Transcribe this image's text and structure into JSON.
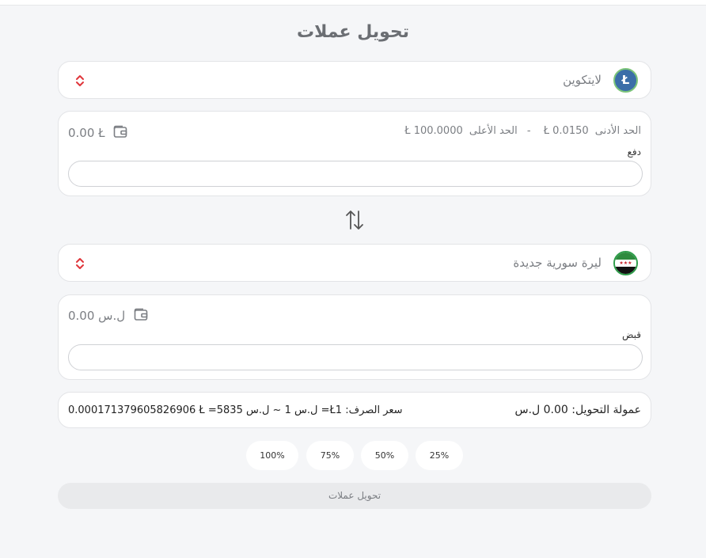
{
  "page": {
    "title": "تحويل عملات"
  },
  "from": {
    "currency_name": "لايتكوين",
    "coin_symbol": "Ł",
    "balance": "0.00 Ł",
    "limits": {
      "min_label": "الحد الأدنى",
      "min_value": "Ł 0.0150",
      "separator": "-",
      "max_label": "الحد الأعلى",
      "max_value": "Ł 100.0000"
    },
    "field_label": "دفع",
    "input_value": "",
    "colors": {
      "coin_bg": "#3b6ea8",
      "coin_ring": "#7cc47a"
    }
  },
  "to": {
    "currency_name": "ليرة سورية جديدة",
    "balance": "0.00 ل.س",
    "field_label": "قبض",
    "input_value": "",
    "colors": {
      "flag_green": "#2e8b3e",
      "flag_red": "#c9242c"
    }
  },
  "icons": {
    "selector": "chevron-up-down-icon",
    "swap": "swap-arrows-icon",
    "balance": "wallet-icon"
  },
  "rate": {
    "fee": "عمولة التحويل: 0.00 ل.س",
    "exchange": "0.000171379605826906 Ł =ل.س 1 ~ ل.س 5835 =Ł1 :سعر الصرف"
  },
  "percent_buttons": [
    "25%",
    "50%",
    "75%",
    "100%"
  ],
  "submit": {
    "label": "تحويل عملات"
  },
  "accent": "#e0363b"
}
